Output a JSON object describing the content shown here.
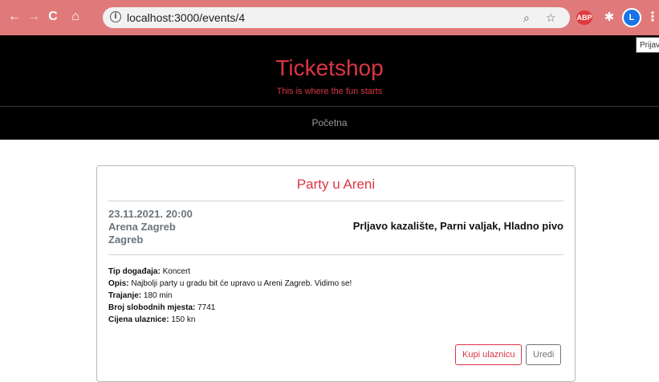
{
  "browser": {
    "url": "localhost:3000/events/4",
    "avatar_letter": "L",
    "abp_label": "ABP",
    "tooltip": "Prijav"
  },
  "site": {
    "title": "Ticketshop",
    "subtitle": "This is where the fun starts",
    "nav": [
      "Početna"
    ]
  },
  "event": {
    "title": "Party u Areni",
    "datetime": "23.11.2021. 20:00",
    "venue": "Arena Zagreb",
    "city": "Zagreb",
    "performers": "Prljavo kazalište, Parni valjak, Hladno pivo",
    "details": [
      {
        "label": "Tip događaja:",
        "value": "Koncert"
      },
      {
        "label": "Opis:",
        "value": "Najbolji party u gradu bit će upravo u Areni Zagreb. Vidimo se!"
      },
      {
        "label": "Trajanje:",
        "value": "180 min"
      },
      {
        "label": "Broj slobodnih mjesta:",
        "value": "7741"
      },
      {
        "label": "Cijena ulaznice:",
        "value": "150 kn"
      }
    ],
    "buy_label": "Kupi ulaznicu",
    "edit_label": "Uredi"
  }
}
